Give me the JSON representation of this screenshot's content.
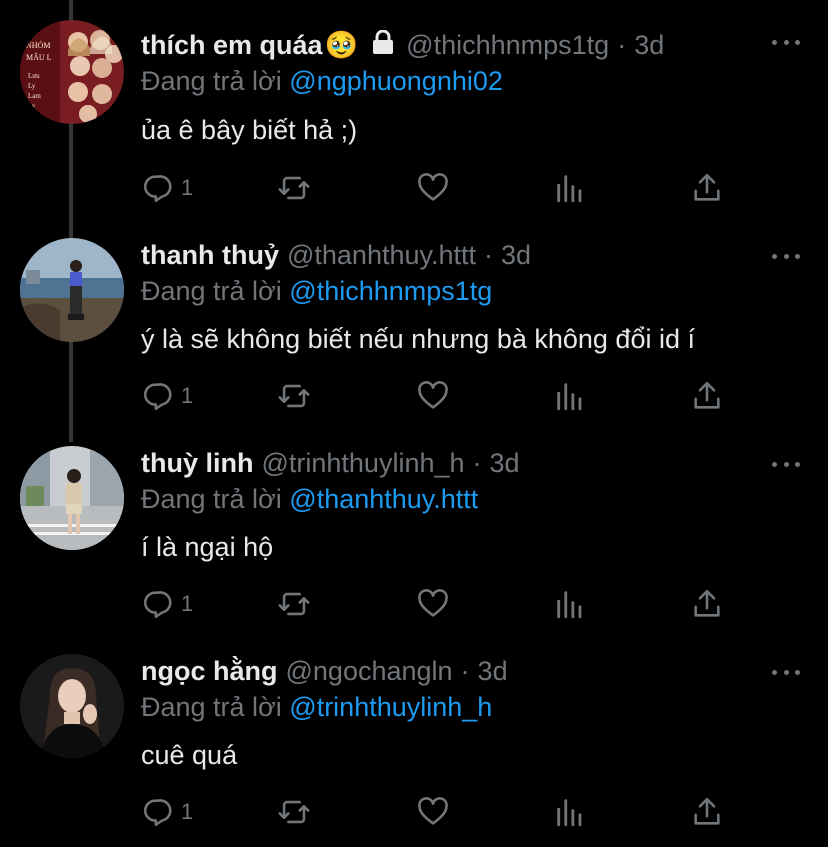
{
  "reply_prefix": "Đang trả lời",
  "tweets": [
    {
      "name": "thích em quáa",
      "emoji": "🥹",
      "has_lock": true,
      "handle": "@thichhnmps1tg",
      "sep": "·",
      "time": "3d",
      "reply_to": "@ngphuongnhi02",
      "text": "ủa ê bây biết hả ;)",
      "reply_count": "1"
    },
    {
      "name": "thanh thuỷ",
      "handle": "@thanhthuy.httt",
      "sep": "·",
      "time": "3d",
      "reply_to": "@thichhnmps1tg",
      "text": "ý là sẽ không biết nếu nhưng bà không đổi id í",
      "reply_count": "1"
    },
    {
      "name": "thuỳ linh",
      "handle": "@trinhthuylinh_h",
      "sep": "·",
      "time": "3d",
      "reply_to": "@thanhthuy.httt",
      "text": "í là ngại hộ",
      "reply_count": "1"
    },
    {
      "name": "ngọc hằng",
      "handle": "@ngochangln",
      "sep": "·",
      "time": "3d",
      "reply_to": "@trinhthuylinh_h",
      "text": "cuê quá",
      "reply_count": "1"
    }
  ],
  "avatar_text": [
    "NHÓM",
    "MÂU L",
    "Lưu",
    "Ly",
    "Lam",
    "Ly"
  ],
  "colors": {
    "background": "#000000",
    "text": "#e7e9ea",
    "muted": "#71767b",
    "link": "#1d9bf0",
    "thread_line": "#333639"
  }
}
